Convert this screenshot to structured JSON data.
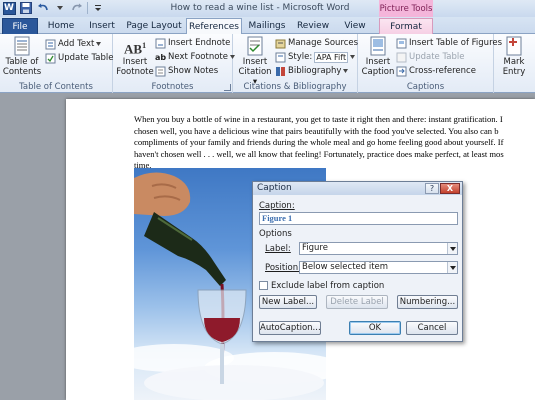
{
  "window": {
    "title": "How to read a wine list - Microsoft Word",
    "context_tool_title": "Picture Tools",
    "app_icon_letter": "W"
  },
  "tabs": [
    {
      "label": "File",
      "state": "file"
    },
    {
      "label": "Home"
    },
    {
      "label": "Insert"
    },
    {
      "label": "Page Layout"
    },
    {
      "label": "References",
      "state": "active"
    },
    {
      "label": "Mailings"
    },
    {
      "label": "Review"
    },
    {
      "label": "View"
    },
    {
      "label": "Format",
      "state": "context"
    }
  ],
  "ribbon": {
    "toc": {
      "group_label": "Table of Contents",
      "table_of_contents_line1": "Table of",
      "table_of_contents_line2": "Contents",
      "add_text": "Add Text",
      "update_table": "Update Table"
    },
    "footnotes": {
      "group_label": "Footnotes",
      "insert_footnote_line1": "Insert",
      "insert_footnote_line2": "Footnote",
      "insert_endnote": "Insert Endnote",
      "next_footnote": "Next Footnote",
      "show_notes": "Show Notes",
      "icon_text": "AB",
      "icon_sup": "1"
    },
    "citations": {
      "group_label": "Citations & Bibliography",
      "insert_citation_line1": "Insert",
      "insert_citation_line2": "Citation",
      "manage_sources": "Manage Sources",
      "style_label": "Style:",
      "style_value": "APA Fift",
      "bibliography": "Bibliography"
    },
    "captions": {
      "group_label": "Captions",
      "insert_caption_line1": "Insert",
      "insert_caption_line2": "Caption",
      "insert_table_of_figures": "Insert Table of Figures",
      "update_table": "Update Table",
      "cross_reference": "Cross-reference"
    },
    "index": {
      "mark_entry_line1": "Mark",
      "mark_entry_line2": "Entry"
    }
  },
  "document": {
    "lines": [
      "When you buy a bottle of wine in a restaurant, you get to taste it right then and there: instant gratification. I",
      "chosen well, you have a delicious wine that pairs beautifully with the food you've selected. You also can b",
      "compliments of your family  and friends during the whole meal  and go home feeling good about yourself. If",
      "haven't chosen well . . . well,  we all know that feeling! Fortunately, practice does make perfect, at least mos",
      "time."
    ]
  },
  "dialog": {
    "title": "Caption",
    "help_label": "?",
    "close_label": "X",
    "caption_label": "Caption:",
    "caption_value": "Figure 1",
    "options_label": "Options",
    "label_label": "Label:",
    "label_value": "Figure",
    "position_label": "Position:",
    "position_value": "Below selected item",
    "exclude_label": "Exclude label from caption",
    "exclude_checked": false,
    "new_label_button": "New Label...",
    "delete_label_button": "Delete Label",
    "numbering_button": "Numbering...",
    "autocaption_button": "AutoCaption...",
    "ok_button": "OK",
    "cancel_button": "Cancel"
  },
  "colors": {
    "file_tab": "#2b579a",
    "context_tab": "#f4b5da",
    "caption_text": "#3d6fb0"
  }
}
